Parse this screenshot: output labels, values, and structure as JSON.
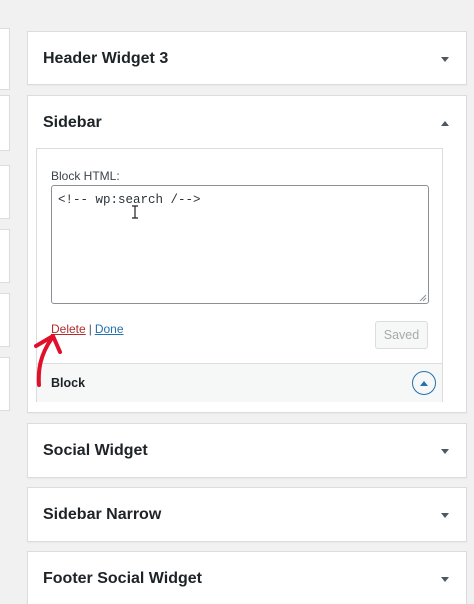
{
  "areas": [
    {
      "title": "Header Widget 3",
      "state": "collapsed",
      "toggle_icon": "caret-down-icon"
    },
    {
      "title": "Sidebar",
      "state": "expanded",
      "toggle_icon": "caret-up-icon"
    },
    {
      "title": "Social Widget",
      "state": "collapsed",
      "toggle_icon": "caret-down-icon"
    },
    {
      "title": "Sidebar Narrow",
      "state": "collapsed",
      "toggle_icon": "caret-down-icon"
    },
    {
      "title": "Footer Social Widget",
      "state": "collapsed",
      "toggle_icon": "caret-down-icon"
    }
  ],
  "widget": {
    "field_label": "Block HTML:",
    "content": "<!-- wp:search /-->",
    "delete_label": "Delete",
    "separator": "|",
    "done_label": "Done",
    "saved_label": "Saved",
    "block_title": "Block"
  },
  "colors": {
    "background": "#f1f1f1",
    "delete_link": "#b32d2e",
    "done_link": "#2271b1",
    "annotation_arrow": "#e0102b"
  }
}
